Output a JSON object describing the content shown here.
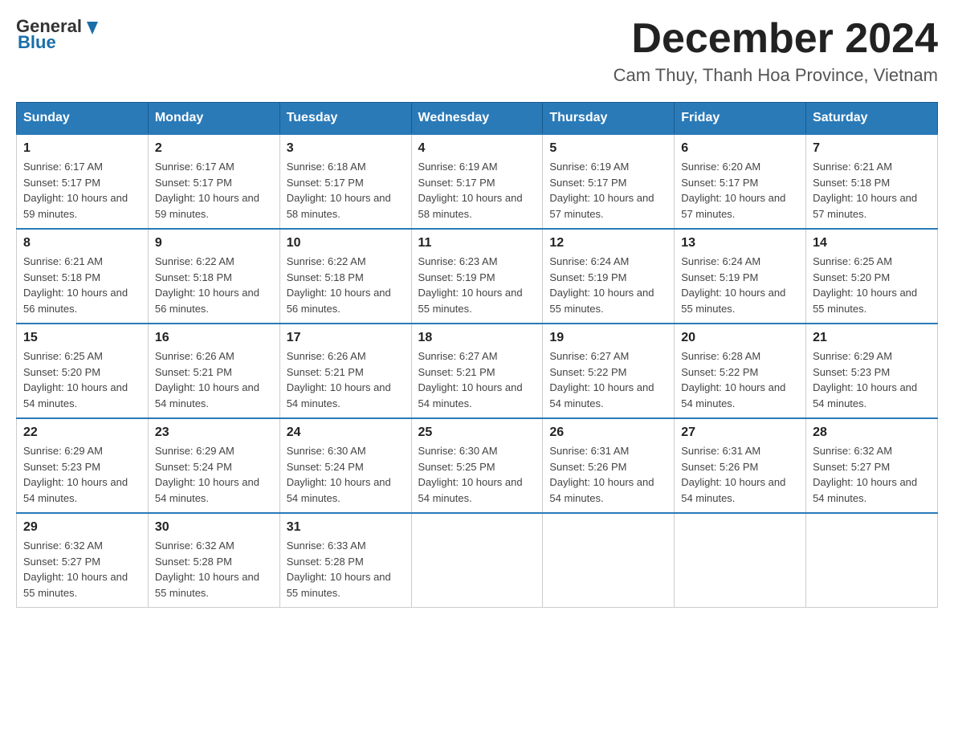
{
  "header": {
    "logo": {
      "text_general": "General",
      "text_blue": "Blue"
    },
    "title": "December 2024",
    "location": "Cam Thuy, Thanh Hoa Province, Vietnam"
  },
  "days_of_week": [
    "Sunday",
    "Monday",
    "Tuesday",
    "Wednesday",
    "Thursday",
    "Friday",
    "Saturday"
  ],
  "weeks": [
    [
      {
        "day": "1",
        "sunrise": "6:17 AM",
        "sunset": "5:17 PM",
        "daylight": "10 hours and 59 minutes."
      },
      {
        "day": "2",
        "sunrise": "6:17 AM",
        "sunset": "5:17 PM",
        "daylight": "10 hours and 59 minutes."
      },
      {
        "day": "3",
        "sunrise": "6:18 AM",
        "sunset": "5:17 PM",
        "daylight": "10 hours and 58 minutes."
      },
      {
        "day": "4",
        "sunrise": "6:19 AM",
        "sunset": "5:17 PM",
        "daylight": "10 hours and 58 minutes."
      },
      {
        "day": "5",
        "sunrise": "6:19 AM",
        "sunset": "5:17 PM",
        "daylight": "10 hours and 57 minutes."
      },
      {
        "day": "6",
        "sunrise": "6:20 AM",
        "sunset": "5:17 PM",
        "daylight": "10 hours and 57 minutes."
      },
      {
        "day": "7",
        "sunrise": "6:21 AM",
        "sunset": "5:18 PM",
        "daylight": "10 hours and 57 minutes."
      }
    ],
    [
      {
        "day": "8",
        "sunrise": "6:21 AM",
        "sunset": "5:18 PM",
        "daylight": "10 hours and 56 minutes."
      },
      {
        "day": "9",
        "sunrise": "6:22 AM",
        "sunset": "5:18 PM",
        "daylight": "10 hours and 56 minutes."
      },
      {
        "day": "10",
        "sunrise": "6:22 AM",
        "sunset": "5:18 PM",
        "daylight": "10 hours and 56 minutes."
      },
      {
        "day": "11",
        "sunrise": "6:23 AM",
        "sunset": "5:19 PM",
        "daylight": "10 hours and 55 minutes."
      },
      {
        "day": "12",
        "sunrise": "6:24 AM",
        "sunset": "5:19 PM",
        "daylight": "10 hours and 55 minutes."
      },
      {
        "day": "13",
        "sunrise": "6:24 AM",
        "sunset": "5:19 PM",
        "daylight": "10 hours and 55 minutes."
      },
      {
        "day": "14",
        "sunrise": "6:25 AM",
        "sunset": "5:20 PM",
        "daylight": "10 hours and 55 minutes."
      }
    ],
    [
      {
        "day": "15",
        "sunrise": "6:25 AM",
        "sunset": "5:20 PM",
        "daylight": "10 hours and 54 minutes."
      },
      {
        "day": "16",
        "sunrise": "6:26 AM",
        "sunset": "5:21 PM",
        "daylight": "10 hours and 54 minutes."
      },
      {
        "day": "17",
        "sunrise": "6:26 AM",
        "sunset": "5:21 PM",
        "daylight": "10 hours and 54 minutes."
      },
      {
        "day": "18",
        "sunrise": "6:27 AM",
        "sunset": "5:21 PM",
        "daylight": "10 hours and 54 minutes."
      },
      {
        "day": "19",
        "sunrise": "6:27 AM",
        "sunset": "5:22 PM",
        "daylight": "10 hours and 54 minutes."
      },
      {
        "day": "20",
        "sunrise": "6:28 AM",
        "sunset": "5:22 PM",
        "daylight": "10 hours and 54 minutes."
      },
      {
        "day": "21",
        "sunrise": "6:29 AM",
        "sunset": "5:23 PM",
        "daylight": "10 hours and 54 minutes."
      }
    ],
    [
      {
        "day": "22",
        "sunrise": "6:29 AM",
        "sunset": "5:23 PM",
        "daylight": "10 hours and 54 minutes."
      },
      {
        "day": "23",
        "sunrise": "6:29 AM",
        "sunset": "5:24 PM",
        "daylight": "10 hours and 54 minutes."
      },
      {
        "day": "24",
        "sunrise": "6:30 AM",
        "sunset": "5:24 PM",
        "daylight": "10 hours and 54 minutes."
      },
      {
        "day": "25",
        "sunrise": "6:30 AM",
        "sunset": "5:25 PM",
        "daylight": "10 hours and 54 minutes."
      },
      {
        "day": "26",
        "sunrise": "6:31 AM",
        "sunset": "5:26 PM",
        "daylight": "10 hours and 54 minutes."
      },
      {
        "day": "27",
        "sunrise": "6:31 AM",
        "sunset": "5:26 PM",
        "daylight": "10 hours and 54 minutes."
      },
      {
        "day": "28",
        "sunrise": "6:32 AM",
        "sunset": "5:27 PM",
        "daylight": "10 hours and 54 minutes."
      }
    ],
    [
      {
        "day": "29",
        "sunrise": "6:32 AM",
        "sunset": "5:27 PM",
        "daylight": "10 hours and 55 minutes."
      },
      {
        "day": "30",
        "sunrise": "6:32 AM",
        "sunset": "5:28 PM",
        "daylight": "10 hours and 55 minutes."
      },
      {
        "day": "31",
        "sunrise": "6:33 AM",
        "sunset": "5:28 PM",
        "daylight": "10 hours and 55 minutes."
      },
      null,
      null,
      null,
      null
    ]
  ]
}
